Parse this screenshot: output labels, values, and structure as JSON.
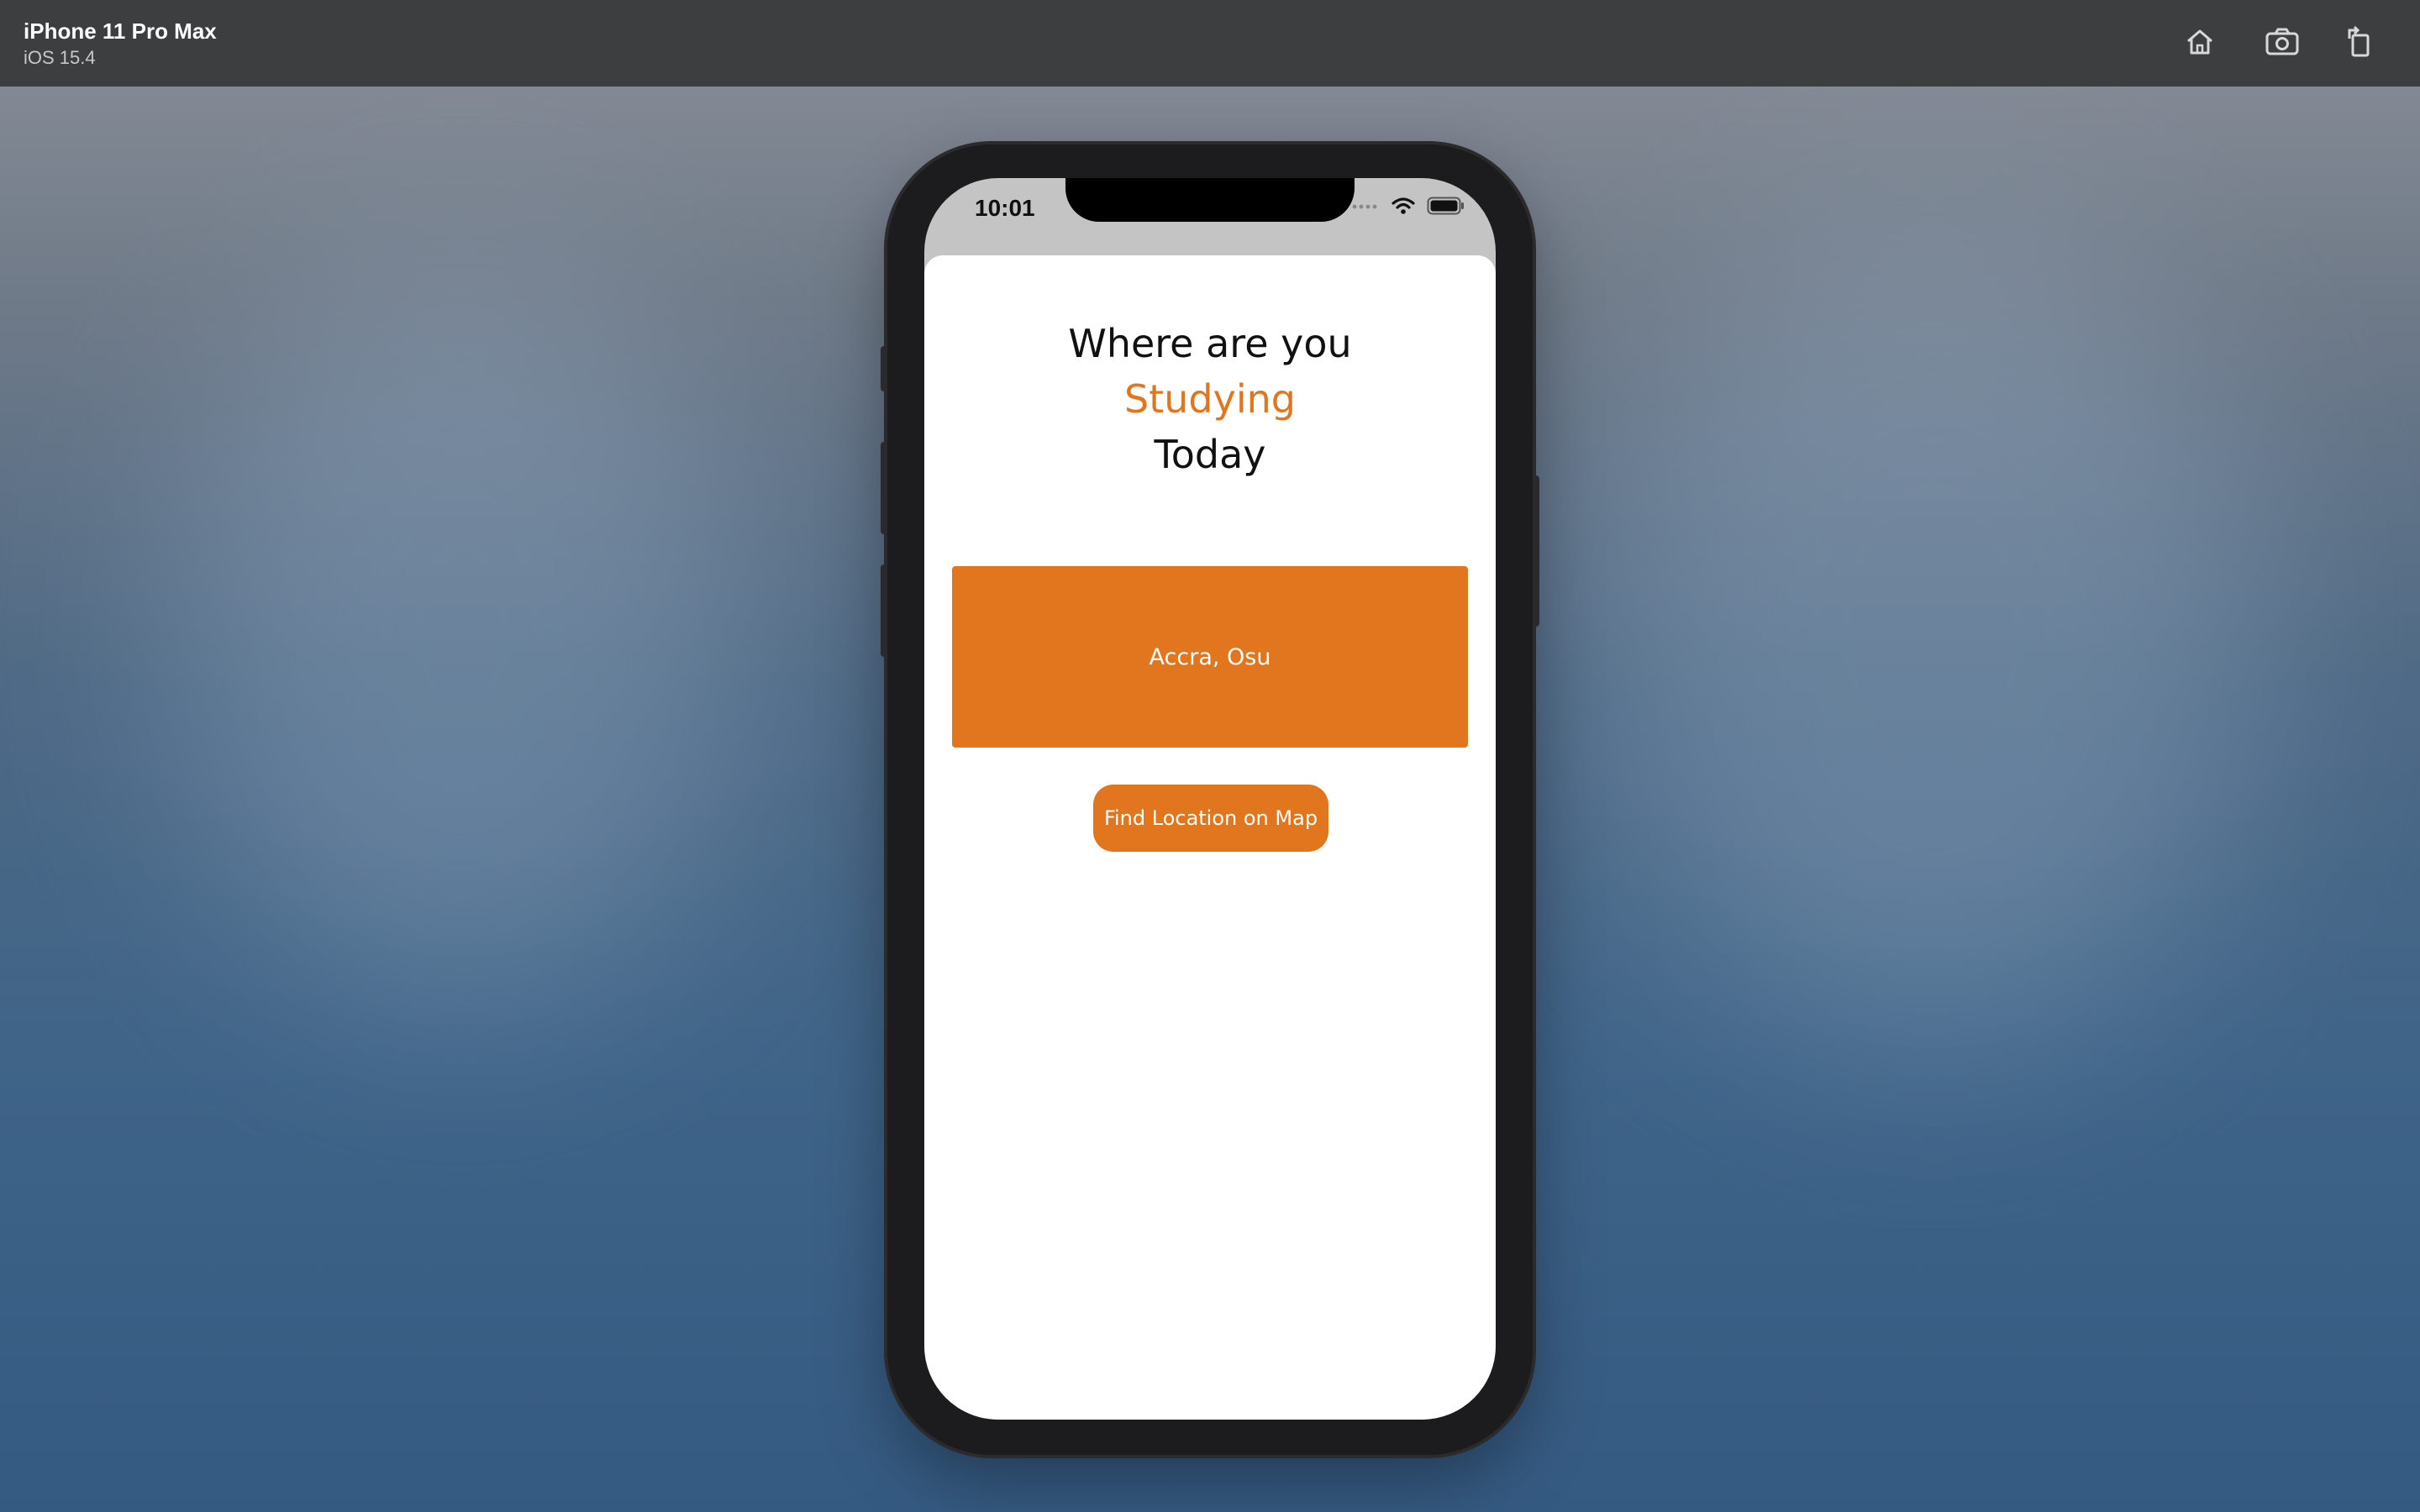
{
  "simulator": {
    "device_name": "iPhone 11 Pro Max",
    "os_version": "iOS 15.4",
    "buttons": {
      "home": "home-icon",
      "screenshot": "camera-icon",
      "rotate": "rotate-icon"
    }
  },
  "status_bar": {
    "time": "10:01"
  },
  "screen": {
    "heading_line1": "Where are you",
    "heading_line2": "Studying",
    "heading_line3": "Today",
    "location_value": "Accra, Osu",
    "find_button_label": "Find Location on Map"
  },
  "colors": {
    "accent": "#e1761e",
    "sim_bar": "#3d3e40"
  }
}
